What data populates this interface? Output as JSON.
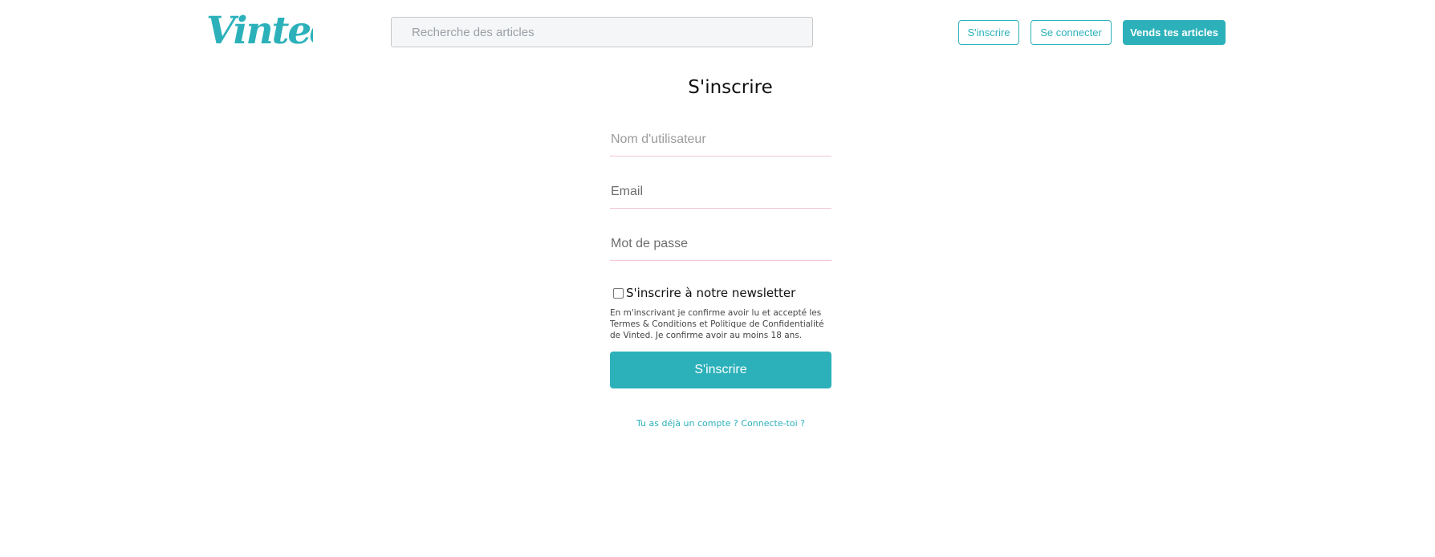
{
  "header": {
    "logo_text": "Vinted",
    "search_placeholder": "Recherche des articles",
    "signup_label": "S'inscrire",
    "login_label": "Se connecter",
    "sell_label": "Vends tes articles"
  },
  "form": {
    "title": "S'inscrire",
    "username_placeholder": "Nom d'utilisateur",
    "email_placeholder": "Email",
    "password_placeholder": "Mot de passe",
    "newsletter_label": "S'inscrire à notre newsletter",
    "legal_text": "En m'inscrivant je confirme avoir lu et accepté les Termes & Conditions et Politique de Confidentialité de Vinted. Je confirme avoir au moins 18 ans.",
    "submit_label": "S'inscrire",
    "login_link": "Tu as déjà un compte ? Connecte-toi ?"
  },
  "colors": {
    "accent": "#2cb1ba",
    "field_underline": "#f2c6d2"
  }
}
